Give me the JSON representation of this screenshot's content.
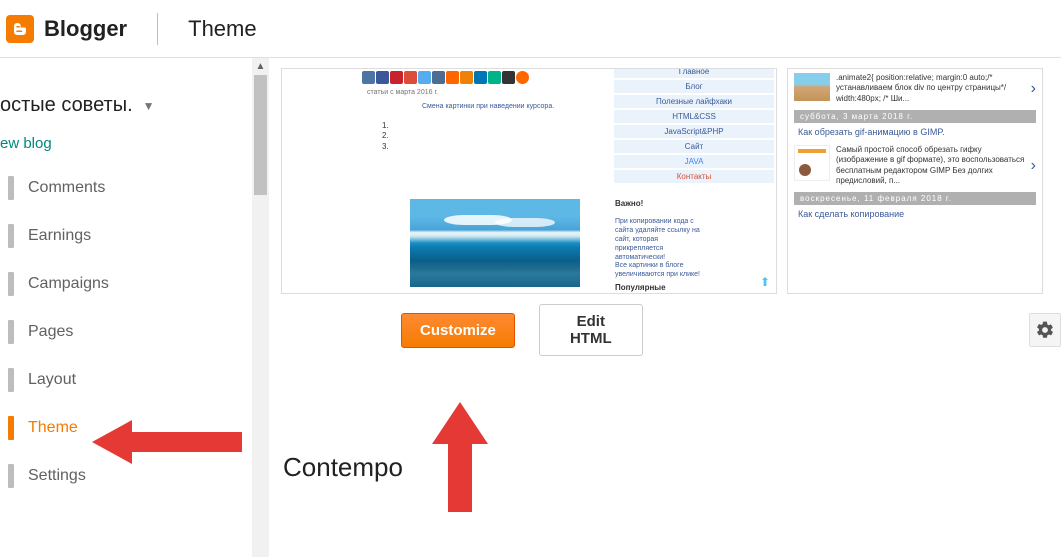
{
  "header": {
    "brand": "Blogger",
    "page_title": "Theme"
  },
  "blog": {
    "name": "остые советы.",
    "view_link": "ew blog"
  },
  "sidebar": {
    "items": [
      {
        "label": "Comments"
      },
      {
        "label": "Earnings"
      },
      {
        "label": "Campaigns"
      },
      {
        "label": "Pages"
      },
      {
        "label": "Layout"
      },
      {
        "label": "Theme"
      },
      {
        "label": "Settings"
      }
    ]
  },
  "buttons": {
    "customize": "Customize",
    "edit_html": "Edit HTML"
  },
  "section_title": "Contempo",
  "preview": {
    "menu": [
      "Главное",
      "Блог",
      "Полезные лайфхаки",
      "HTML&CSS",
      "JavaScript&PHP",
      "Сайт",
      "JAVA",
      "Контакты"
    ],
    "subtitle_grey": "статьи с марта 2016 г.",
    "link1": "Смена картинки при наведении курсора.",
    "heading_important": "Важно!",
    "link2": "При копировании кода с сайта удаляйте ссылку на сайт, которая прикрепляется автоматически!",
    "link3": "Все картинки в блоге увеличиваются при клике!",
    "heading_popular": "Популярные",
    "list": [
      "1.",
      "2.",
      "3."
    ]
  },
  "side_preview": {
    "snippet1": ".animate2{ position:relative; margin:0 auto;/* устанавливаем блок div по центру страницы*/ width:480px; /* Ши...",
    "date1": "суббота, 3 марта 2018 г.",
    "link1": "Как обрезать gif-анимацию в GIMP.",
    "snippet2": "Самый простой способ обрезать гифку (изображение в gif формате), это воспользоваться бесплатным редактором GIMP Без долгих предисловий, п...",
    "date2": "воскресенье, 11 февраля 2018 г.",
    "link2": "Как сделать копирование"
  }
}
